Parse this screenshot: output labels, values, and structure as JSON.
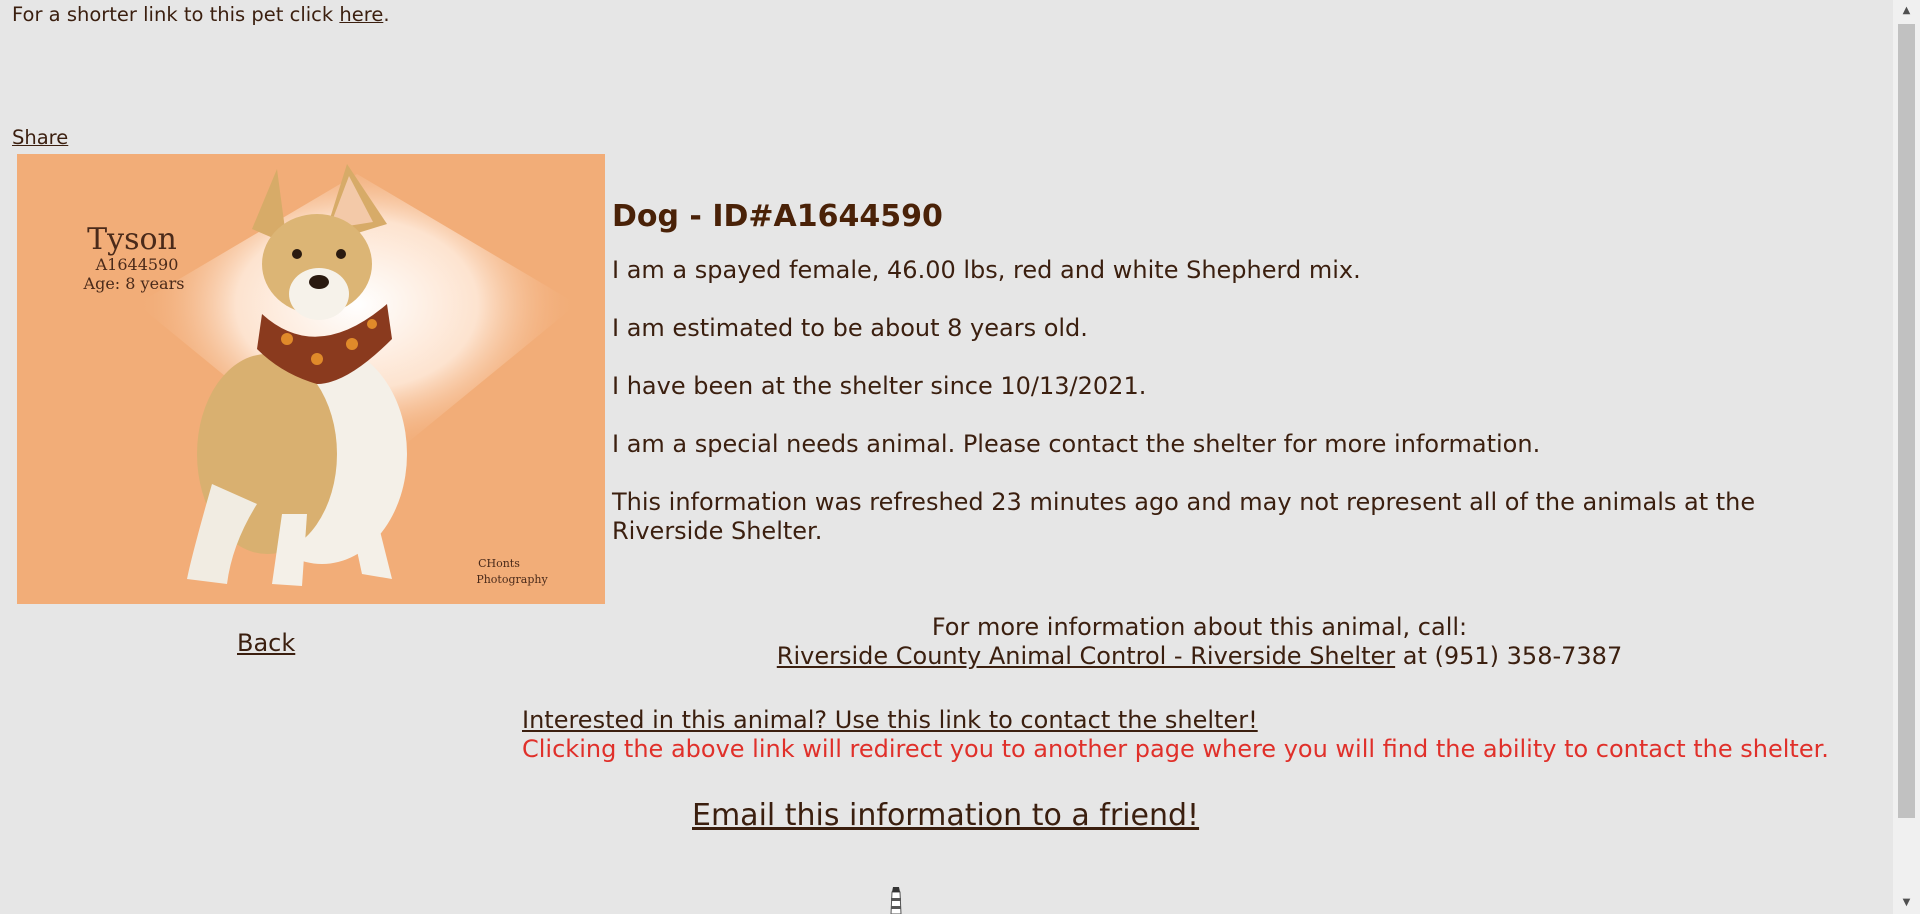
{
  "shortlink": {
    "prefix": "For a shorter link to this pet click ",
    "link_label": "here",
    "suffix": "."
  },
  "share_label": "Share",
  "photo": {
    "name": "Tyson",
    "id": "A1644590",
    "age": "Age: 8 years",
    "credit_line1": "CHonts",
    "credit_line2": "Photography",
    "background_color": "#f2ad78"
  },
  "back_label": "Back",
  "info": {
    "heading": "Dog - ID#A1644590",
    "line1": "I am a spayed female, 46.00 lbs, red and white Shepherd mix.",
    "line2": "I am estimated to be about 8 years old.",
    "line3": "I have been at the shelter since 10/13/2021.",
    "line4": "I am a special needs animal. Please contact the shelter for more information.",
    "line5": "This information was refreshed 23 minutes ago and may not represent all of the animals at the Riverside Shelter."
  },
  "contact": {
    "intro": "For more information about this animal, call:",
    "shelter_link": "Riverside County Animal Control - Riverside Shelter",
    "phone_text": " at (951) 358-7387"
  },
  "interested": {
    "link_label": "Interested in this animal? Use this link to contact the shelter!",
    "warning": "Clicking the above link will redirect you to another page where you will find the ability to contact the shelter."
  },
  "email_label": "Email this information to a friend!",
  "colors": {
    "text": "#3b1f0f",
    "heading": "#4a2208",
    "warning": "#e0302a",
    "background": "#e6e6e6"
  }
}
